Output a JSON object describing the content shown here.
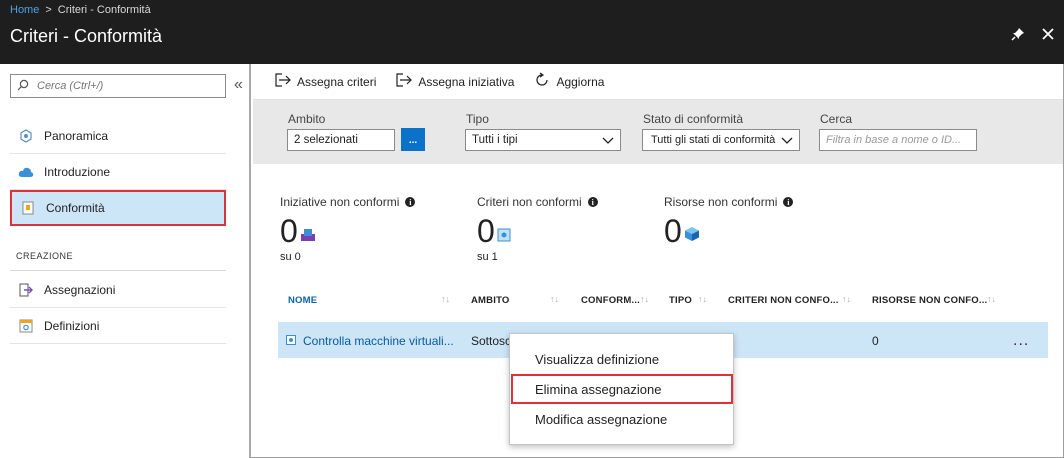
{
  "header": {
    "breadcrumb": [
      {
        "label": "Home"
      },
      {
        "label": "Criteri - Conformità"
      }
    ],
    "breadcrumb_sep": ">",
    "title": "Criteri - Conformità",
    "pin_icon": "pin-icon",
    "close_icon": "close-icon"
  },
  "sidebar": {
    "search_placeholder": "Cerca (Ctrl+/)",
    "collapse": "«",
    "items": [
      {
        "label": "Panoramica",
        "icon": "overview-icon"
      },
      {
        "label": "Introduzione",
        "icon": "cloud-icon"
      },
      {
        "label": "Conformità",
        "icon": "compliance-icon",
        "selected": true
      }
    ],
    "section_title": "CREAZIONE",
    "section_items": [
      {
        "label": "Assegnazioni",
        "icon": "assignment-icon"
      },
      {
        "label": "Definizioni",
        "icon": "definition-icon"
      }
    ]
  },
  "toolbar": {
    "assign_policy": "Assegna criteri",
    "assign_initiative": "Assegna iniziativa",
    "refresh": "Aggiorna"
  },
  "filters": {
    "scope_label": "Ambito",
    "scope_value": "2 selezionati",
    "scope_button": "...",
    "type_label": "Tipo",
    "type_value": "Tutti i tipi",
    "state_label": "Stato di conformità",
    "state_value": "Tutti gli stati di conformità",
    "search_label": "Cerca",
    "search_placeholder": "Filtra in base a nome o ID..."
  },
  "stats": [
    {
      "label": "Iniziative non conformi",
      "value": "0",
      "sub": "su 0"
    },
    {
      "label": "Criteri non conformi",
      "value": "0",
      "sub": "su 1"
    },
    {
      "label": "Risorse non conformi",
      "value": "0",
      "sub": ""
    }
  ],
  "table": {
    "headers": [
      "NOME",
      "AMBITO",
      "CONFORM...",
      "TIPO",
      "CRITERI NON CONFO...",
      "RISORSE NON CONFO..."
    ],
    "rows": [
      {
        "name": "Controlla macchine virtuali...",
        "scope": "Sottosc",
        "resources": "0",
        "more": "..."
      }
    ]
  },
  "context_menu": {
    "items": [
      "Visualizza definizione",
      "Elimina assegnazione",
      "Modifica assegnazione"
    ]
  },
  "colors": {
    "header_bg": "#1e1e1e",
    "accent": "#0a72c8",
    "selection": "#cde6f7",
    "highlight_border": "#e0313a"
  }
}
